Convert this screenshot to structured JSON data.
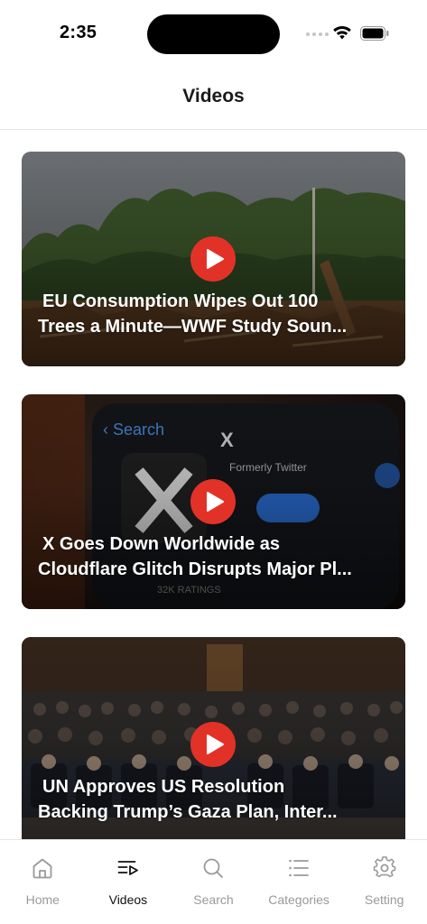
{
  "status_bar": {
    "time": "2:35"
  },
  "header": {
    "title": "Videos"
  },
  "videos": [
    {
      "title_line1": "EU Consumption Wipes Out 100",
      "title_line2": "Trees a Minute—WWF Study Soun..."
    },
    {
      "title_line1": "X Goes Down Worldwide as",
      "title_line2": "Cloudflare Glitch Disrupts Major Pl..."
    },
    {
      "title_line1": "UN Approves US Resolution",
      "title_line2": "Backing Trump’s Gaza Plan, Inter..."
    }
  ],
  "tabbar": {
    "items": [
      {
        "label": "Home",
        "icon": "home-icon"
      },
      {
        "label": "Videos",
        "icon": "videos-icon",
        "active": true
      },
      {
        "label": "Search",
        "icon": "search-icon"
      },
      {
        "label": "Categories",
        "icon": "categories-icon"
      },
      {
        "label": "Setting",
        "icon": "gear-icon"
      }
    ]
  },
  "colors": {
    "play_button": "#e23227",
    "active_tab": "#111111",
    "inactive_tab": "#9a9a9a"
  }
}
